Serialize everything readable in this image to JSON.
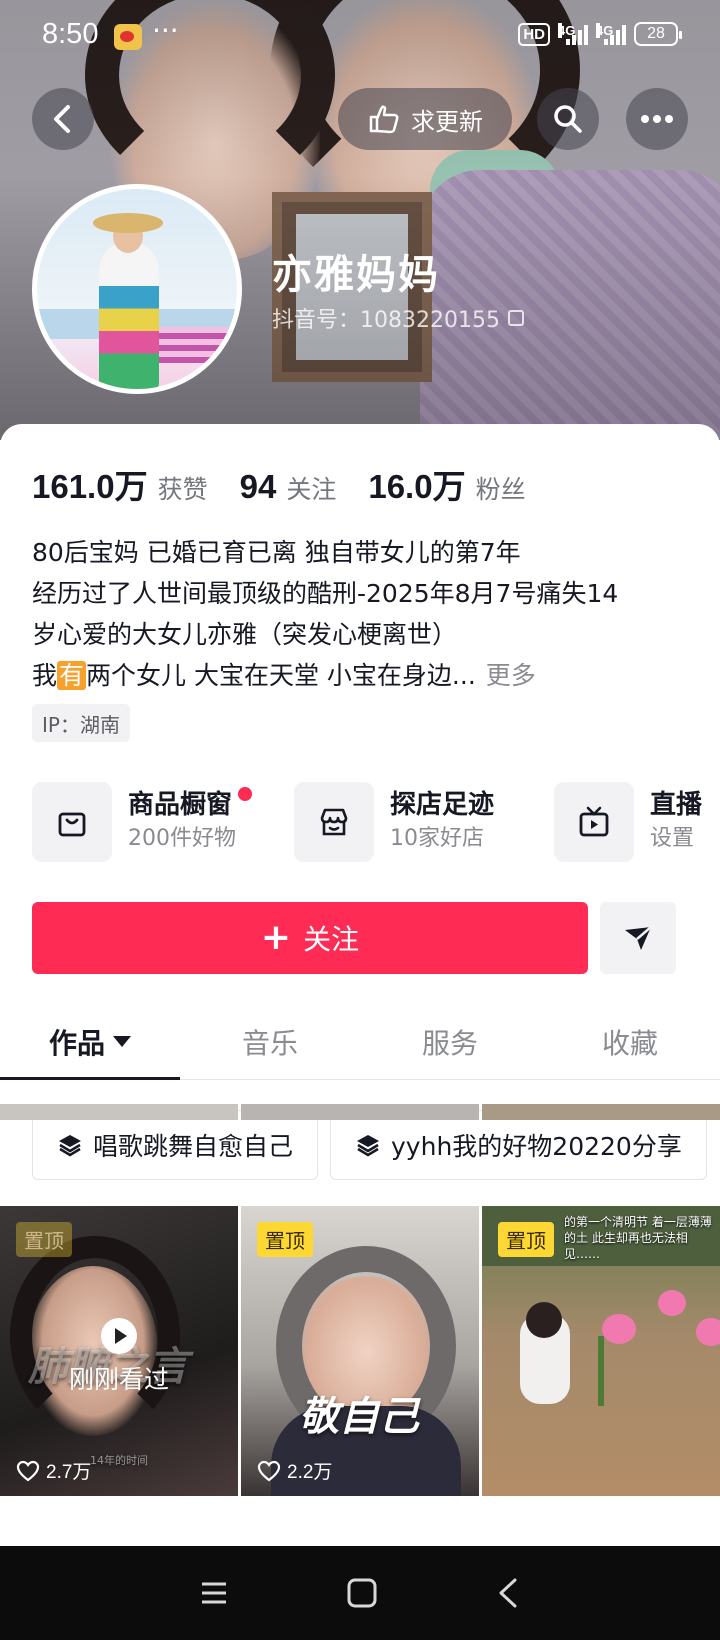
{
  "status_bar": {
    "time": "8:50",
    "dots": "···",
    "hd": "HD",
    "net1": "4G",
    "net2": "4G",
    "battery": "28"
  },
  "header": {
    "update_label": "求更新",
    "nickname": "亦雅妈妈",
    "douyin_id": "抖音号：1083220155"
  },
  "stats": [
    {
      "num": "161.0万",
      "label": "获赞"
    },
    {
      "num": "94",
      "label": "关注"
    },
    {
      "num": "16.0万",
      "label": "粉丝"
    }
  ],
  "bio": {
    "line1": "80后宝妈 已婚已育已离 独自带女儿的第7年",
    "line2": "经历过了人世间最顶级的酷刑-2025年8月7号痛失14",
    "line3": "岁心爱的大女儿亦雅（突发心梗离世）",
    "line4_pre": "我",
    "line4_hl": "有",
    "line4_post": "两个女儿 大宝在天堂 小宝在身边...",
    "more": "更多"
  },
  "ip": "IP：湖南",
  "services": [
    {
      "title": "商品橱窗",
      "sub": "200件好物"
    },
    {
      "title": "探店足迹",
      "sub": "10家好店"
    },
    {
      "title": "直播",
      "sub": "设置"
    }
  ],
  "follow_label": "关注",
  "tabs": [
    "作品",
    "音乐",
    "服务",
    "收藏"
  ],
  "collections": [
    "唱歌跳舞自愈自己",
    "yyhh我的好物20220分享"
  ],
  "videos": [
    {
      "pin": "置顶",
      "likes": "2.7万",
      "overlay": "刚刚看过",
      "big_text": "肺腑之言",
      "small_text": "14年的时间"
    },
    {
      "pin": "置顶",
      "likes": "2.2万",
      "big_text": "敬自己"
    },
    {
      "pin": "置顶",
      "caption": "的第一个清明节 着一层薄薄的土 此生却再也无法相见……"
    }
  ],
  "colors": {
    "accent": "#fe2c55",
    "pin": "#fdd835",
    "text_primary": "#161823",
    "text_secondary": "#8a8b91"
  }
}
